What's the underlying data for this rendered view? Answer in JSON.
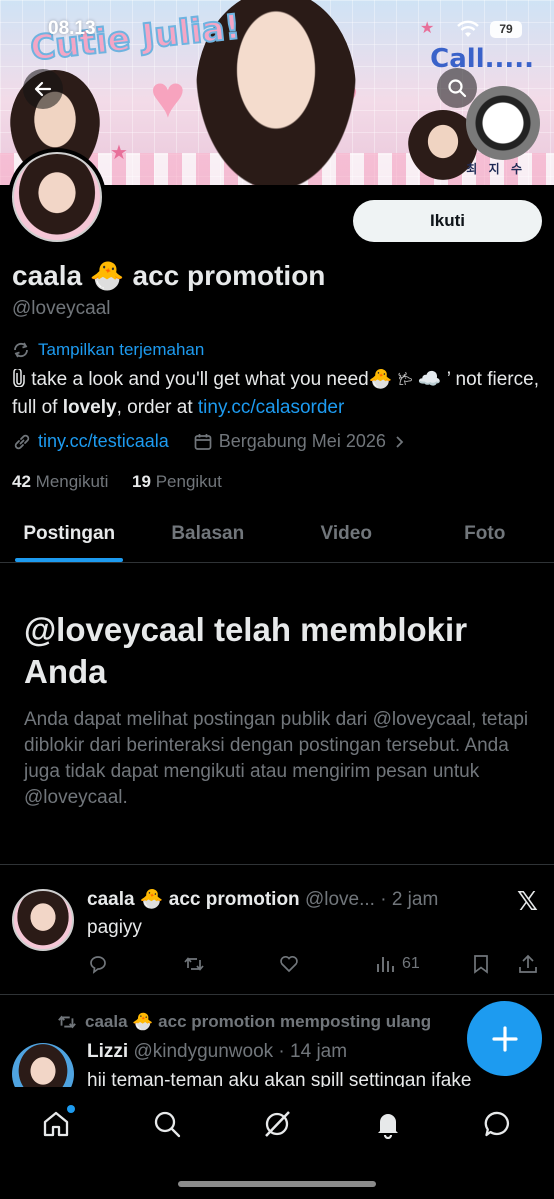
{
  "status_bar": {
    "time": "08.13",
    "battery": "79"
  },
  "banner": {
    "deco_text": "Cutie Julia!",
    "deco_call": "Call.....",
    "deco_name": "최 지 수"
  },
  "profile": {
    "follow_label": "Ikuti",
    "display_name": "caala 🐣 acc promotion",
    "handle": "@loveycaal",
    "translate_label": "Tampilkan terjemahan",
    "bio_part1": "take a look and you'll get what you need🐣 ",
    "bio_part2": " ☁️ ’ not fierce, full of ",
    "bio_bold": "lovely",
    "bio_part3": ", order at ",
    "bio_link": "tiny.cc/calasorder",
    "website": "tiny.cc/testicaala",
    "joined": "Bergabung Mei 2026",
    "following_count": "42",
    "following_label": "Mengikuti",
    "followers_count": "19",
    "followers_label": "Pengikut"
  },
  "tabs": [
    {
      "label": "Postingan"
    },
    {
      "label": "Balasan"
    },
    {
      "label": "Video"
    },
    {
      "label": "Foto"
    }
  ],
  "blocked": {
    "title": "@loveycaal telah memblokir Anda",
    "text": "Anda dapat melihat postingan publik dari @loveycaal, tetapi diblokir dari berinteraksi dengan postingan tersebut. Anda juga tidak dapat mengikuti atau mengirim pesan untuk @loveycaal."
  },
  "post1": {
    "name": "caala 🐣 acc promotion",
    "handle_time": "@love... · 2 jam",
    "text": "pagiyy",
    "views": "61"
  },
  "post2": {
    "repost_label": "caala 🐣 acc promotion memposting ulang",
    "name": "Lizzi",
    "handle_time": "@kindygunwook · 14 jam",
    "text": "hii teman-teman aku akan spill settingan ifake"
  },
  "colors": {
    "accent": "#1d9bf0",
    "background": "#000000",
    "muted": "#71767b"
  },
  "icons": [
    "back-arrow-icon",
    "search-icon",
    "translate-icon",
    "link-icon",
    "calendar-icon",
    "chevron-right-icon",
    "reply-icon",
    "repost-icon",
    "like-icon",
    "views-icon",
    "bookmark-icon",
    "share-icon",
    "x-logo-icon",
    "plus-icon",
    "home-icon",
    "explore-icon",
    "grok-icon",
    "notifications-icon",
    "messages-icon"
  ]
}
